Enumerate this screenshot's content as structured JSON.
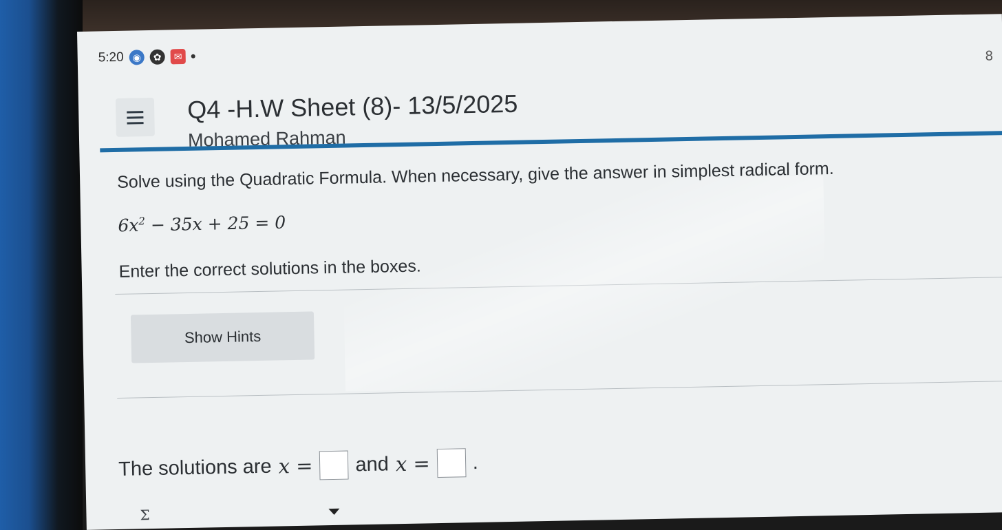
{
  "status_bar": {
    "time": "5:20"
  },
  "header": {
    "title": "Q4 -H.W Sheet (8)- 13/5/2025",
    "student_name": "Mohamed Rahman",
    "page_number": "8"
  },
  "question": {
    "prompt": "Solve using the Quadratic Formula. When necessary, give the answer in simplest radical form.",
    "equation_lhs_coef": "6x",
    "equation_exp": "2",
    "equation_rest": " − 35x + 25 = 0",
    "instruction": "Enter the correct solutions in the boxes."
  },
  "hints": {
    "button_label": "Show Hints"
  },
  "answer": {
    "prefix": "The solutions are",
    "var1": "x =",
    "joiner": "and",
    "var2": "x =",
    "suffix": ".",
    "box1_value": "",
    "box2_value": ""
  },
  "toolbar": {
    "sigma_label": "Σ"
  },
  "icons": {
    "menu": "hamburger-menu-icon",
    "expand": "caret-down-icon"
  },
  "colors": {
    "accent_rule": "#1f6da6",
    "screen_bg": "#eef1f2"
  }
}
